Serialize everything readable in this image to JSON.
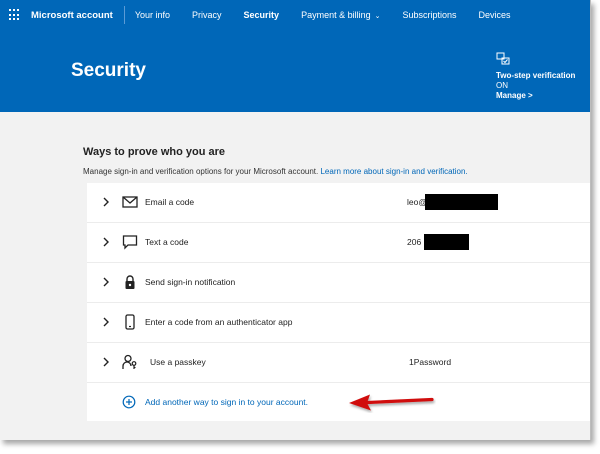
{
  "nav": {
    "brand": "Microsoft account",
    "items": [
      {
        "label": "Your info"
      },
      {
        "label": "Privacy"
      },
      {
        "label": "Security"
      },
      {
        "label": "Payment & billing"
      },
      {
        "label": "Subscriptions"
      },
      {
        "label": "Devices"
      }
    ],
    "active": "Security"
  },
  "banner": {
    "title": "Security",
    "two_step": {
      "title": "Two-step verification",
      "status": "ON",
      "manage": "Manage >"
    }
  },
  "section": {
    "title": "Ways to prove who you are",
    "description": "Manage sign-in and verification options for your Microsoft account.",
    "link": "Learn more about sign-in and verification."
  },
  "methods": [
    {
      "label": "Email a code",
      "icon": "envelope-icon",
      "value": "leo@"
    },
    {
      "label": "Text a code",
      "icon": "chat-bubble-icon",
      "value": "206"
    },
    {
      "label": "Send sign-in notification",
      "icon": "lock-icon",
      "value": ""
    },
    {
      "label": "Enter a code from an authenticator app",
      "icon": "phone-icon",
      "value": ""
    },
    {
      "label": "Use a passkey",
      "icon": "person-key-icon",
      "value": "1Password"
    }
  ],
  "add_method": {
    "label": "Add another way to sign in to your account.",
    "icon": "plus-circle-icon"
  },
  "colors": {
    "brand_blue": "#0067b8",
    "page_bg": "#f2f2f2",
    "arrow_red": "#d01010"
  }
}
